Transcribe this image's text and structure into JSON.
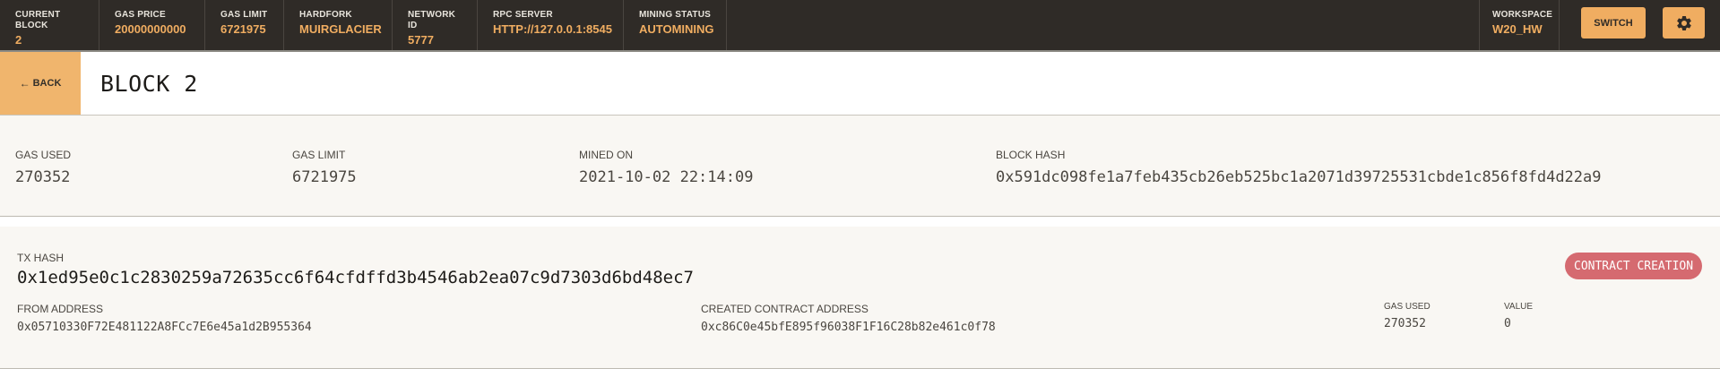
{
  "topbar": {
    "stats": [
      {
        "label": "CURRENT BLOCK",
        "value": "2"
      },
      {
        "label": "GAS PRICE",
        "value": "20000000000"
      },
      {
        "label": "GAS LIMIT",
        "value": "6721975"
      },
      {
        "label": "HARDFORK",
        "value": "MUIRGLACIER"
      },
      {
        "label": "NETWORK ID",
        "value": "5777"
      },
      {
        "label": "RPC SERVER",
        "value": "HTTP://127.0.0.1:8545"
      },
      {
        "label": "MINING STATUS",
        "value": "AUTOMINING"
      }
    ],
    "workspace": {
      "label": "WORKSPACE",
      "value": "W20_HW"
    },
    "switch_label": "SWITCH",
    "settings_icon": "gear-icon"
  },
  "header": {
    "back_label": "BACK",
    "back_icon": "arrow-left-icon",
    "title": "BLOCK 2"
  },
  "block": {
    "gas_used": {
      "label": "GAS USED",
      "value": "270352"
    },
    "gas_limit": {
      "label": "GAS LIMIT",
      "value": "6721975"
    },
    "mined_on": {
      "label": "MINED ON",
      "value": "2021-10-02 22:14:09"
    },
    "block_hash": {
      "label": "BLOCK HASH",
      "value": "0x591dc098fe1a7feb435cb26eb525bc1a2071d39725531cbde1c856f8fd4d22a9"
    }
  },
  "transaction": {
    "hash_label": "TX HASH",
    "hash": "0x1ed95e0c1c2830259a72635cc6f64cfdffd3b4546ab2ea07c9d7303d6bd48ec7",
    "badge": "CONTRACT CREATION",
    "from": {
      "label": "FROM ADDRESS",
      "value": "0x05710330F72E481122A8FCc7E6e45a1d2B955364"
    },
    "contract": {
      "label": "CREATED CONTRACT ADDRESS",
      "value": "0xc86C0e45bfE895f96038F1F16C28b82e461c0f78"
    },
    "gas_used": {
      "label": "GAS USED",
      "value": "270352"
    },
    "value": {
      "label": "VALUE",
      "value": "0"
    }
  },
  "colors": {
    "topbar_bg": "#2f2b27",
    "accent": "#f0ad61",
    "badge": "#d56a70",
    "panel_bg": "#f9f7f3"
  }
}
